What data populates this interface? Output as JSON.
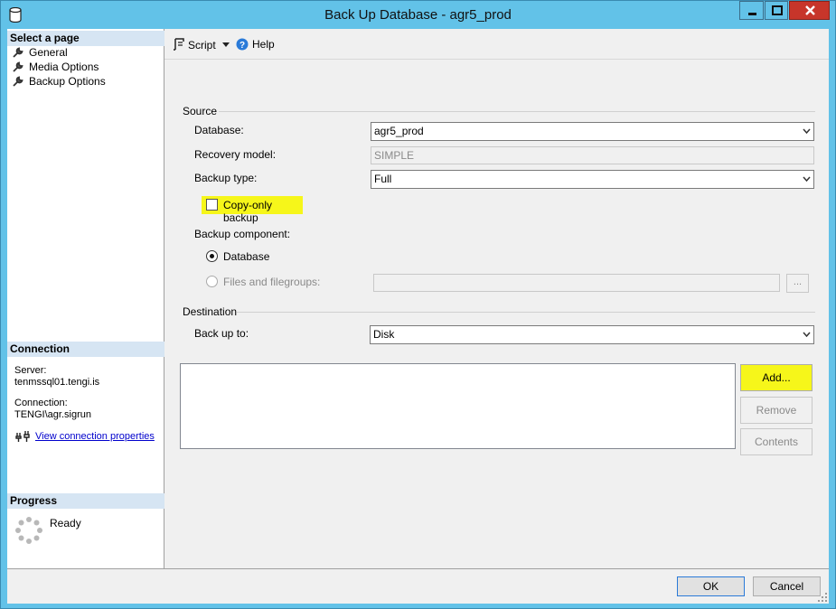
{
  "window": {
    "title": "Back Up Database - agr5_prod"
  },
  "left": {
    "select_page_header": "Select a page",
    "pages": [
      {
        "label": "General",
        "icon": "wrench-icon"
      },
      {
        "label": "Media Options",
        "icon": "wrench-icon"
      },
      {
        "label": "Backup Options",
        "icon": "wrench-icon"
      }
    ],
    "connection_header": "Connection",
    "server_label": "Server:",
    "server_value": "tenmssql01.tengi.is",
    "connection_label": "Connection:",
    "connection_value": "TENGI\\agr.sigrun",
    "view_connection_link": "View connection properties",
    "progress_header": "Progress",
    "progress_status": "Ready"
  },
  "toolbar": {
    "script_label": "Script",
    "help_label": "Help"
  },
  "source": {
    "group_label": "Source",
    "database_label": "Database:",
    "database_value": "agr5_prod",
    "recovery_label": "Recovery model:",
    "recovery_value": "SIMPLE",
    "backup_type_label": "Backup type:",
    "backup_type_value": "Full",
    "copy_only_label": "Copy-only backup",
    "copy_only_checked": false,
    "component_label": "Backup component:",
    "component_database": "Database",
    "component_files": "Files and filegroups:",
    "ellipsis": "..."
  },
  "destination": {
    "group_label": "Destination",
    "back_up_to_label": "Back up to:",
    "back_up_to_value": "Disk",
    "add_button": "Add...",
    "remove_button": "Remove",
    "contents_button": "Contents"
  },
  "footer": {
    "ok_button": "OK",
    "cancel_button": "Cancel"
  },
  "colors": {
    "title_bar": "#62c2e8",
    "highlight": "#f6f61a",
    "section_header": "#d6e5f3",
    "link": "#0000cc",
    "close_button": "#c7352a"
  }
}
